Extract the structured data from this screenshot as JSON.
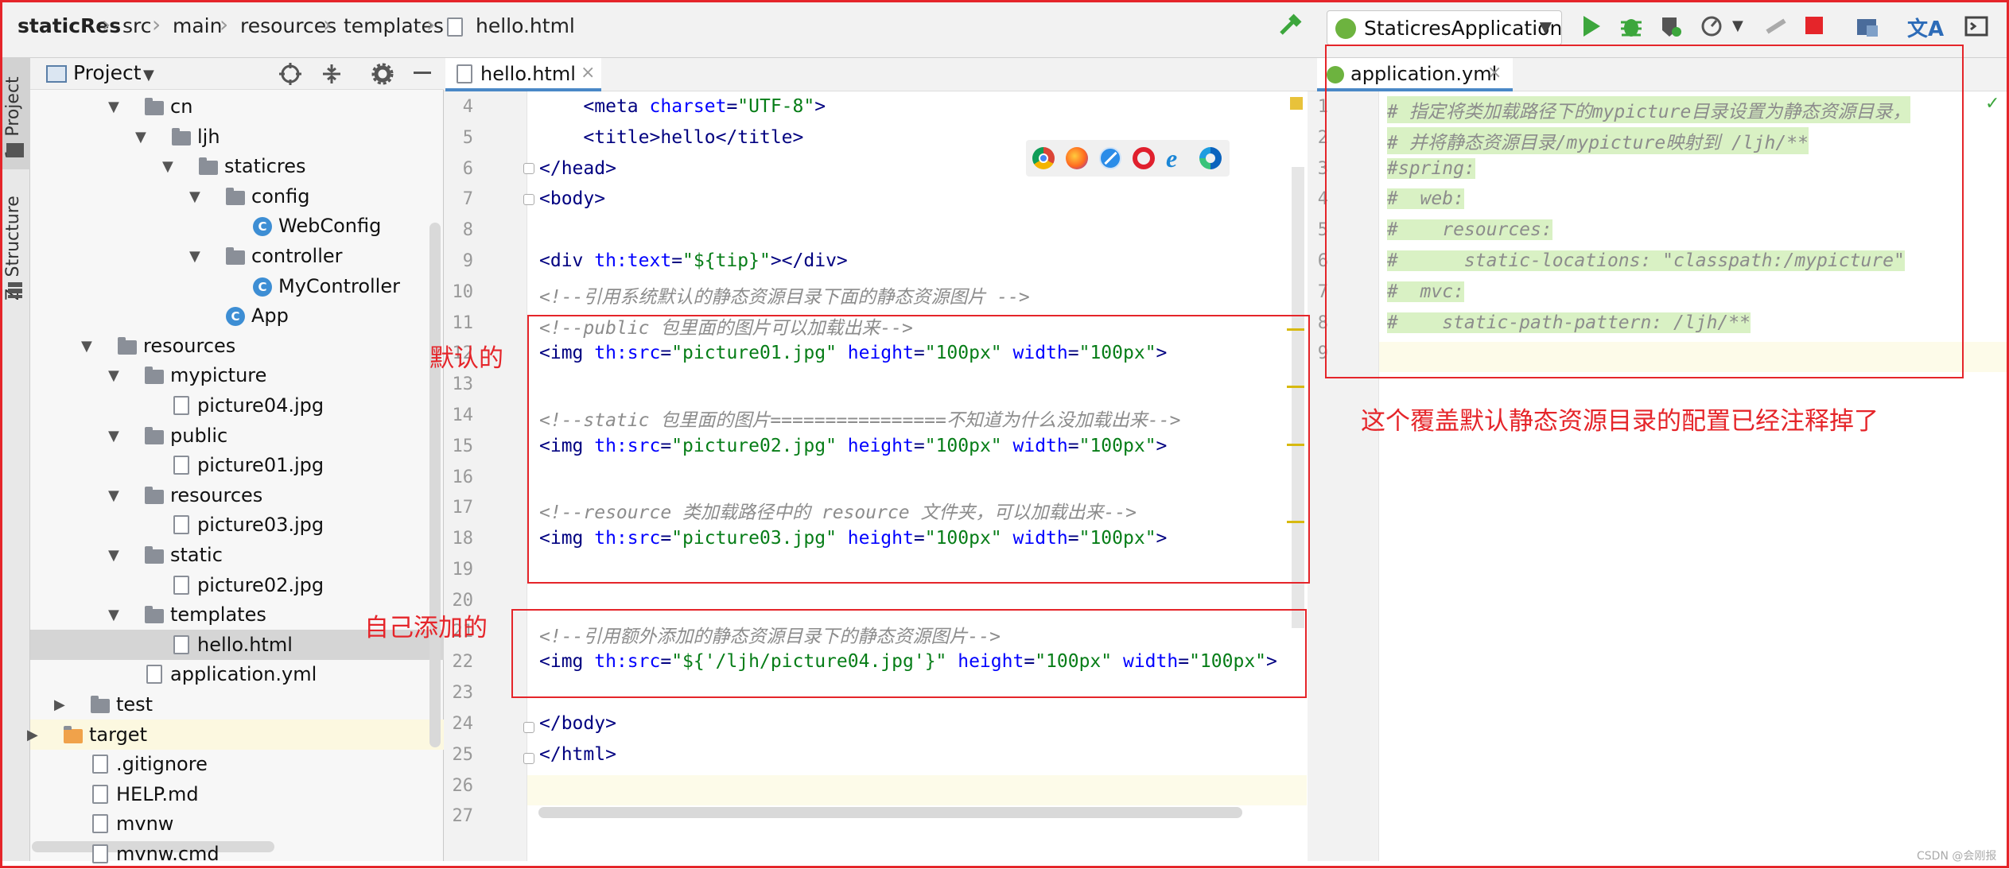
{
  "breadcrumb": [
    "staticRes",
    "src",
    "main",
    "resources",
    "templates",
    "hello.html"
  ],
  "run_config": "StaticresApplication",
  "sidebar_tabs": {
    "project": "1: Project",
    "structure": "Z: Structure"
  },
  "project_panel": {
    "title": "Project"
  },
  "tree": [
    {
      "label": "cn",
      "type": "pkg",
      "depth": 4,
      "open": true
    },
    {
      "label": "ljh",
      "type": "pkg",
      "depth": 5,
      "open": true
    },
    {
      "label": "staticres",
      "type": "pkg",
      "depth": 6,
      "open": true
    },
    {
      "label": "config",
      "type": "pkg",
      "depth": 7,
      "open": true
    },
    {
      "label": "WebConfig",
      "type": "class",
      "depth": 8
    },
    {
      "label": "controller",
      "type": "pkg",
      "depth": 7,
      "open": true
    },
    {
      "label": "MyController",
      "type": "class",
      "depth": 8
    },
    {
      "label": "App",
      "type": "class",
      "depth": 7
    },
    {
      "label": "resources",
      "type": "folder",
      "depth": 3,
      "open": true
    },
    {
      "label": "mypicture",
      "type": "folder",
      "depth": 4,
      "open": true
    },
    {
      "label": "picture04.jpg",
      "type": "file",
      "depth": 5
    },
    {
      "label": "public",
      "type": "folder",
      "depth": 4,
      "open": true
    },
    {
      "label": "picture01.jpg",
      "type": "file",
      "depth": 5
    },
    {
      "label": "resources",
      "type": "folder",
      "depth": 4,
      "open": true
    },
    {
      "label": "picture03.jpg",
      "type": "file",
      "depth": 5
    },
    {
      "label": "static",
      "type": "folder",
      "depth": 4,
      "open": true
    },
    {
      "label": "picture02.jpg",
      "type": "file",
      "depth": 5
    },
    {
      "label": "templates",
      "type": "folder",
      "depth": 4,
      "open": true
    },
    {
      "label": "hello.html",
      "type": "file",
      "depth": 5,
      "selected": true
    },
    {
      "label": "application.yml",
      "type": "file",
      "depth": 4
    },
    {
      "label": "test",
      "type": "folder",
      "depth": 2,
      "open": false
    },
    {
      "label": "target",
      "type": "orange",
      "depth": 1,
      "open": false
    },
    {
      "label": ".gitignore",
      "type": "file",
      "depth": 2
    },
    {
      "label": "HELP.md",
      "type": "file",
      "depth": 2
    },
    {
      "label": "mvnw",
      "type": "file",
      "depth": 2
    },
    {
      "label": "mvnw.cmd",
      "type": "file",
      "depth": 2
    }
  ],
  "editor_tab": "hello.html",
  "code_lines": [
    {
      "n": "4",
      "parts": [
        [
          "    <",
          "tag"
        ],
        [
          "meta ",
          "tag"
        ],
        [
          "charset",
          "attr"
        ],
        [
          "=",
          "tag"
        ],
        [
          "\"UTF-8\"",
          "str"
        ],
        [
          ">",
          "tag"
        ]
      ]
    },
    {
      "n": "5",
      "parts": [
        [
          "    <",
          "tag"
        ],
        [
          "title",
          "tag"
        ],
        [
          ">hello</",
          "tag"
        ],
        [
          "title",
          "tag"
        ],
        [
          ">",
          "tag"
        ]
      ]
    },
    {
      "n": "6",
      "parts": [
        [
          "</",
          "tag"
        ],
        [
          "head",
          "tag"
        ],
        [
          ">",
          "tag"
        ]
      ]
    },
    {
      "n": "7",
      "parts": [
        [
          "<",
          "tag"
        ],
        [
          "body",
          "tag"
        ],
        [
          ">",
          "tag"
        ]
      ]
    },
    {
      "n": "8",
      "parts": []
    },
    {
      "n": "9",
      "parts": [
        [
          "<",
          "tag"
        ],
        [
          "div ",
          "tag"
        ],
        [
          "th:text",
          "attr"
        ],
        [
          "=",
          "tag"
        ],
        [
          "\"${tip}\"",
          "str"
        ],
        [
          "></",
          "tag"
        ],
        [
          "div",
          "tag"
        ],
        [
          ">",
          "tag"
        ]
      ]
    },
    {
      "n": "10",
      "parts": [
        [
          "<!--引用系统默认的静态资源目录下面的静态资源图片 -->",
          "cm"
        ]
      ]
    },
    {
      "n": "11",
      "parts": [
        [
          "<!--public 包里面的图片可以加载出来-->",
          "cm"
        ]
      ]
    },
    {
      "n": "12",
      "parts": [
        [
          "<",
          "tag"
        ],
        [
          "img ",
          "tag"
        ],
        [
          "th:src",
          "attr"
        ],
        [
          "=",
          "tag"
        ],
        [
          "\"picture01.jpg\"",
          "str"
        ],
        [
          " height",
          "attr"
        ],
        [
          "=",
          "tag"
        ],
        [
          "\"100px\"",
          "str"
        ],
        [
          " width",
          "attr"
        ],
        [
          "=",
          "tag"
        ],
        [
          "\"100px\"",
          "str"
        ],
        [
          ">",
          "tag"
        ]
      ]
    },
    {
      "n": "13",
      "parts": []
    },
    {
      "n": "14",
      "parts": [
        [
          "<!--static 包里面的图片================不知道为什么没加载出来-->",
          "cm"
        ]
      ]
    },
    {
      "n": "15",
      "parts": [
        [
          "<",
          "tag"
        ],
        [
          "img ",
          "tag"
        ],
        [
          "th:src",
          "attr"
        ],
        [
          "=",
          "tag"
        ],
        [
          "\"picture02.jpg\"",
          "str"
        ],
        [
          " height",
          "attr"
        ],
        [
          "=",
          "tag"
        ],
        [
          "\"100px\"",
          "str"
        ],
        [
          " width",
          "attr"
        ],
        [
          "=",
          "tag"
        ],
        [
          "\"100px\"",
          "str"
        ],
        [
          ">",
          "tag"
        ]
      ]
    },
    {
      "n": "16",
      "parts": []
    },
    {
      "n": "17",
      "parts": [
        [
          "<!--resource 类加载路径中的 resource 文件夹，可以加载出来-->",
          "cm"
        ]
      ]
    },
    {
      "n": "18",
      "parts": [
        [
          "<",
          "tag"
        ],
        [
          "img ",
          "tag"
        ],
        [
          "th:src",
          "attr"
        ],
        [
          "=",
          "tag"
        ],
        [
          "\"picture03.jpg\"",
          "str"
        ],
        [
          " height",
          "attr"
        ],
        [
          "=",
          "tag"
        ],
        [
          "\"100px\"",
          "str"
        ],
        [
          " width",
          "attr"
        ],
        [
          "=",
          "tag"
        ],
        [
          "\"100px\"",
          "str"
        ],
        [
          ">",
          "tag"
        ]
      ]
    },
    {
      "n": "19",
      "parts": []
    },
    {
      "n": "20",
      "parts": []
    },
    {
      "n": "21",
      "parts": [
        [
          "<!--引用额外添加的静态资源目录下的静态资源图片-->",
          "cm"
        ]
      ]
    },
    {
      "n": "22",
      "parts": [
        [
          "<",
          "tag"
        ],
        [
          "img ",
          "tag"
        ],
        [
          "th:src",
          "attr"
        ],
        [
          "=",
          "tag"
        ],
        [
          "\"${'/ljh/picture04.jpg'}\"",
          "str"
        ],
        [
          " height",
          "attr"
        ],
        [
          "=",
          "tag"
        ],
        [
          "\"100px\"",
          "str"
        ],
        [
          " width",
          "attr"
        ],
        [
          "=",
          "tag"
        ],
        [
          "\"100px\"",
          "str"
        ],
        [
          ">",
          "tag"
        ]
      ]
    },
    {
      "n": "23",
      "parts": []
    },
    {
      "n": "24",
      "parts": [
        [
          "</",
          "tag"
        ],
        [
          "body",
          "tag"
        ],
        [
          ">",
          "tag"
        ]
      ]
    },
    {
      "n": "25",
      "parts": [
        [
          "</",
          "tag"
        ],
        [
          "html",
          "tag"
        ],
        [
          ">",
          "tag"
        ]
      ]
    },
    {
      "n": "26",
      "parts": []
    },
    {
      "n": "27",
      "parts": []
    }
  ],
  "right_tab": "application.yml",
  "yml_lines": [
    {
      "n": "1",
      "text": "# 指定将类加载路径下的mypicture目录设置为静态资源目录，"
    },
    {
      "n": "2",
      "text": "# 并将静态资源目录/mypicture映射到 /ljh/**"
    },
    {
      "n": "3",
      "text": "#spring:"
    },
    {
      "n": "4",
      "text": "#  web:"
    },
    {
      "n": "5",
      "text": "#    resources:"
    },
    {
      "n": "6",
      "text": "#      static-locations: \"classpath:/mypicture\""
    },
    {
      "n": "7",
      "text": "#  mvc:"
    },
    {
      "n": "8",
      "text": "#    static-path-pattern: /ljh/**"
    },
    {
      "n": "9",
      "text": ""
    }
  ],
  "annotations": {
    "default_label": "默认的",
    "added_label": "自己添加的",
    "yml_note": "这个覆盖默认静态资源目录的配置已经注释掉了"
  },
  "watermark": "CSDN @会刚报",
  "browser_icons": [
    "chrome-icon",
    "firefox-icon",
    "safari-icon",
    "opera-icon",
    "ie-icon",
    "edge-icon"
  ],
  "colors": {
    "annotation_red": "#e5252a",
    "yml_highlight": "#d9f1c4",
    "run_green": "#3ca63c",
    "stop_red": "#e5252a"
  }
}
